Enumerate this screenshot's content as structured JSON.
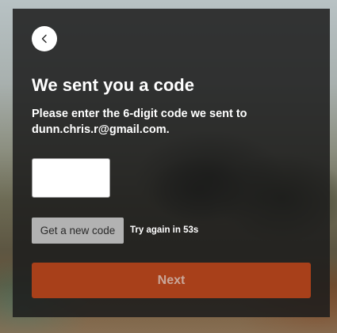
{
  "dialog": {
    "back_icon": "chevron-left-icon",
    "title": "We sent you a code",
    "subtitle": "Please enter the 6-digit code we sent to dunn.chris.r@gmail.com.",
    "code_input": {
      "value": "",
      "placeholder": ""
    },
    "new_code_label": "Get a new code",
    "retry_text": "Try again in 53s",
    "next_label": "Next"
  },
  "colors": {
    "panel_background": "#1c1c1c",
    "next_button": "#a8401a",
    "next_button_text": "#c9a79a",
    "new_code_button": "#b2b2b2"
  }
}
